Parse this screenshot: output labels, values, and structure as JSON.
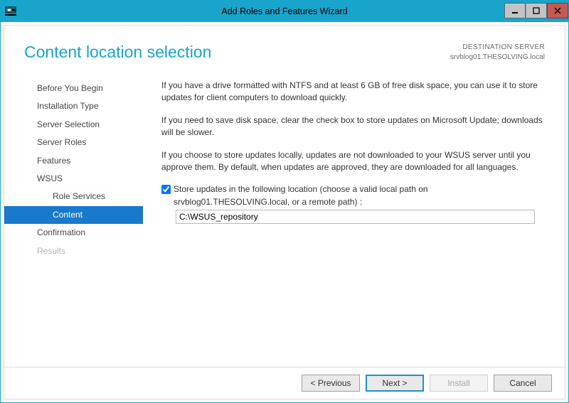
{
  "titlebar": {
    "icon_name": "server-icon",
    "title": "Add Roles and Features Wizard"
  },
  "header": {
    "page_title": "Content location selection",
    "destination_label": "DESTINATION SERVER",
    "destination_server": "srvblog01.THESOLVING.local"
  },
  "nav": {
    "items": [
      {
        "label": "Before You Begin",
        "sub": false,
        "selected": false,
        "disabled": false
      },
      {
        "label": "Installation Type",
        "sub": false,
        "selected": false,
        "disabled": false
      },
      {
        "label": "Server Selection",
        "sub": false,
        "selected": false,
        "disabled": false
      },
      {
        "label": "Server Roles",
        "sub": false,
        "selected": false,
        "disabled": false
      },
      {
        "label": "Features",
        "sub": false,
        "selected": false,
        "disabled": false
      },
      {
        "label": "WSUS",
        "sub": false,
        "selected": false,
        "disabled": false
      },
      {
        "label": "Role Services",
        "sub": true,
        "selected": false,
        "disabled": false
      },
      {
        "label": "Content",
        "sub": true,
        "selected": true,
        "disabled": false
      },
      {
        "label": "Confirmation",
        "sub": false,
        "selected": false,
        "disabled": false
      },
      {
        "label": "Results",
        "sub": false,
        "selected": false,
        "disabled": true
      }
    ]
  },
  "main": {
    "paragraph1": "If you have a drive formatted with NTFS and at least 6 GB of free disk space, you can use it to store updates for client computers to download quickly.",
    "paragraph2": "If you need to save disk space, clear the check box to store updates on Microsoft Update; downloads will be slower.",
    "paragraph3": "If you choose to store updates locally, updates are not downloaded to your WSUS server until you approve them. By default, when updates are approved, they are downloaded for all languages.",
    "checkbox_label_line1": "Store updates in the following location (choose a valid local path on",
    "checkbox_label_line2": "srvblog01.THESOLVING.local, or a remote path) :",
    "checkbox_checked": true,
    "path_value": "C:\\WSUS_repository"
  },
  "footer": {
    "previous": "< Previous",
    "next": "Next >",
    "install": "Install",
    "cancel": "Cancel"
  }
}
